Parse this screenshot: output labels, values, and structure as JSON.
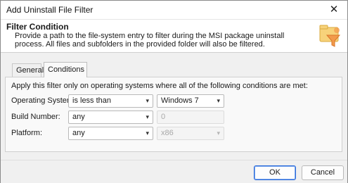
{
  "window": {
    "title": "Add Uninstall File Filter"
  },
  "header": {
    "title": "Filter Condition",
    "description": "Provide a path to the file-system entry to filter during the MSI package uninstall process. All files and subfolders in the provided folder will also be filtered."
  },
  "tabs": [
    {
      "label": "General",
      "active": false
    },
    {
      "label": "Conditions",
      "active": true
    }
  ],
  "conditions": {
    "intro": "Apply this filter only on operating systems where all of the following conditions are met:",
    "rows": [
      {
        "label": "Operating System:",
        "operator": "is less than",
        "value": "Windows 7",
        "value_enabled": true
      },
      {
        "label": "Build Number:",
        "operator": "any",
        "value": "0",
        "value_enabled": false
      },
      {
        "label": "Platform:",
        "operator": "any",
        "value": "x86",
        "value_enabled": false
      }
    ]
  },
  "buttons": {
    "ok": "OK",
    "cancel": "Cancel"
  },
  "icons": {
    "close": "close-icon",
    "header": "folder-filter-icon",
    "dropdown": "chevron-down-icon"
  },
  "colors": {
    "accent": "#2a6ad9",
    "icon_orange": "#f29a4b",
    "icon_folder": "#f7d27a"
  }
}
